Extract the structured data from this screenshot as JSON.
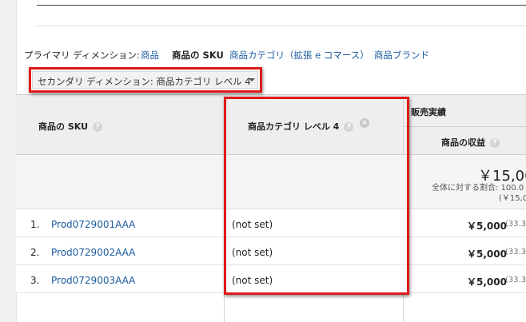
{
  "primary_dimension": {
    "label": "プライマリ ディメンション:",
    "options": [
      "商品",
      "商品の SKU",
      "商品カテゴリ（拡張 e コマース）",
      "商品ブランド"
    ],
    "selected": "商品の SKU"
  },
  "secondary_dimension": {
    "label": "セカンダリ ディメンション: 商品カテゴリ レベル 4"
  },
  "table": {
    "col_sku": "商品の SKU",
    "col_category": "商品カテゴリ レベル 4",
    "group_sales": "販売実績",
    "col_revenue": "商品の収益",
    "help_glyph": "?",
    "remove_glyph": "×",
    "totals": {
      "revenue": "￥15,00",
      "share": "全体に対する割合: 100.0",
      "overall": "(￥15,00"
    },
    "rows": [
      {
        "index": "1.",
        "sku": "Prod0729001AAA",
        "category": "(not set)",
        "revenue": "￥5,000",
        "pct": "(33.3"
      },
      {
        "index": "2.",
        "sku": "Prod0729002AAA",
        "category": "(not set)",
        "revenue": "￥5,000",
        "pct": "(33.3"
      },
      {
        "index": "3.",
        "sku": "Prod0729003AAA",
        "category": "(not set)",
        "revenue": "￥5,000",
        "pct": "(33.3"
      }
    ]
  },
  "colors": {
    "highlight": "#e01a1a",
    "link": "#1a5b9e",
    "header_bg": "#eeeeee"
  }
}
